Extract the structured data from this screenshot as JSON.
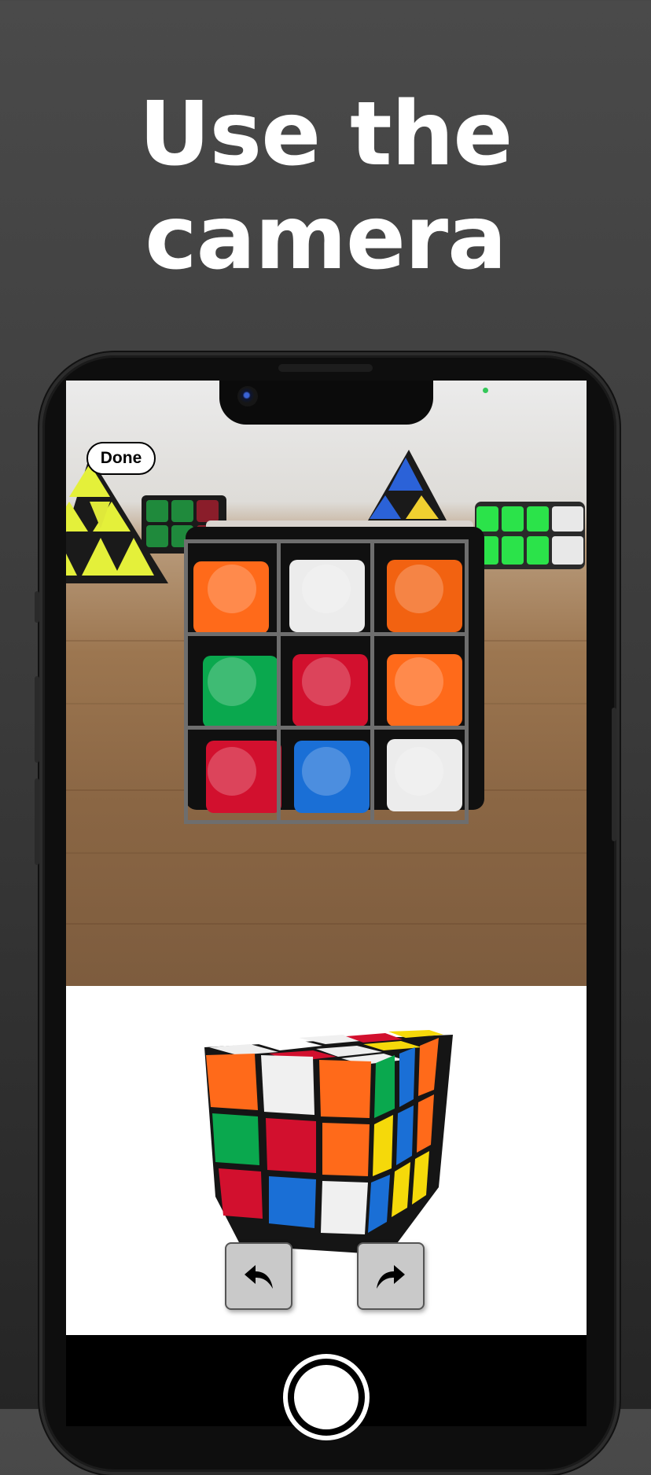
{
  "headline": {
    "line1": "Use the",
    "line2": "camera"
  },
  "camera": {
    "done_label": "Done"
  },
  "scan_grid": {
    "rows": [
      [
        "orange",
        "white",
        "orange"
      ],
      [
        "green",
        "red",
        "orange"
      ],
      [
        "red",
        "blue",
        "white"
      ]
    ]
  },
  "colors": {
    "orange": "#ff6a1a",
    "white": "#f0f0f0",
    "green": "#0aa84e",
    "red": "#d2102e",
    "blue": "#1a6fd6",
    "yellow": "#f5d90a",
    "accent_green_dot": "#34c759"
  },
  "controls": {
    "undo_icon": "undo-arrow-icon",
    "redo_icon": "redo-arrow-icon",
    "shutter_icon": "shutter-icon"
  }
}
